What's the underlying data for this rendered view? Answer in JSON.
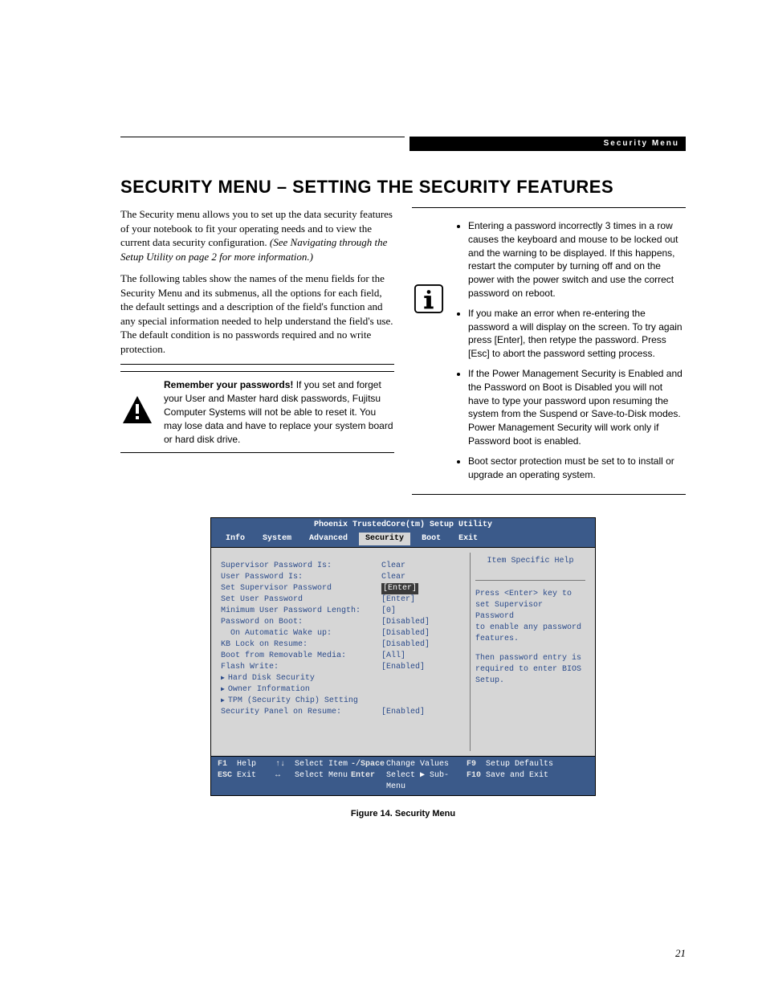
{
  "header": {
    "band": "Security Menu"
  },
  "title": "SECURITY MENU – SETTING THE SECURITY FEATURES",
  "left": {
    "p1a": "The Security menu allows you to set up the data security features of your notebook to fit your operating needs and to view the current data security configuration. ",
    "p1b": "(See Navigating through the Setup Utility on page 2 for more information.)",
    "p2": "The following tables show the names of the menu fields for the Security Menu and its submenus, all the options for each field, the default settings and a description of the field's function and any special information needed to help understand the field's use. The default condition is no passwords required and no write protection.",
    "warn_strong": "Remember your passwords!",
    "warn_text": " If you set and forget your User and Master hard disk passwords, Fujitsu Computer Systems will not be able to reset it. You may lose data and have to replace your system board or hard disk drive."
  },
  "right": {
    "b1": "Entering a password incorrectly 3 times in a row causes the keyboard and mouse to be locked out and the warning to be displayed. If this happens, restart the computer by turning off and on the power with the power switch and use the correct password on reboot.",
    "b2": "If you make an error when re-entering the password a will display on the screen. To try again press [Enter], then retype the password. Press [Esc] to abort the password setting process.",
    "b3": "If the Power Management Security is Enabled and the Password on Boot is Disabled you will not have to type your password upon resuming the system from the Suspend or Save-to-Disk modes. Power Management Security will work only if Password boot is enabled.",
    "b4": "Boot sector protection must be set to to install or upgrade an operating system."
  },
  "bios": {
    "utility_title": "Phoenix TrustedCore(tm) Setup Utility",
    "tabs": [
      "Info",
      "System",
      "Advanced",
      "Security",
      "Boot",
      "Exit"
    ],
    "active_tab": "Security",
    "fields": [
      {
        "label": "Supervisor Password Is:",
        "value": "Clear"
      },
      {
        "label": "User Password Is:",
        "value": "Clear"
      },
      {
        "label": "",
        "value": ""
      },
      {
        "label": "Set Supervisor Password",
        "value": "[Enter]",
        "selected": true
      },
      {
        "label": "Set User Password",
        "value": "[Enter]"
      },
      {
        "label": "Minimum User Password Length:",
        "value": "[0]"
      },
      {
        "label": "Password on Boot:",
        "value": "[Disabled]"
      },
      {
        "label": "  On Automatic Wake up:",
        "value": "[Disabled]"
      },
      {
        "label": "KB Lock on Resume:",
        "value": "[Disabled]"
      },
      {
        "label": "Boot from Removable Media:",
        "value": "[All]"
      },
      {
        "label": "Flash Write:",
        "value": "[Enabled]"
      },
      {
        "label": "Hard Disk Security",
        "value": "",
        "submenu": true
      },
      {
        "label": "Owner Information",
        "value": "",
        "submenu": true
      },
      {
        "label": "TPM (Security Chip) Setting",
        "value": "",
        "submenu": true
      },
      {
        "label": "Security Panel on Resume:",
        "value": "[Enabled]"
      }
    ],
    "help": {
      "title": "Item Specific Help",
      "l1": "Press <Enter> key to",
      "l2": "set Supervisor Password",
      "l3": "to enable any password",
      "l4": "features.",
      "l5": "Then password entry is",
      "l6": "required to enter BIOS",
      "l7": "Setup."
    },
    "footer": {
      "k1": "F1",
      "d1": "Help",
      "k2": "↑↓",
      "d2": "Select Item",
      "k3": "-/Space",
      "d3": "Change Values",
      "k4": "F9",
      "d4": "Setup Defaults",
      "k5": "ESC",
      "d5": "Exit",
      "k6": "↔",
      "d6": "Select Menu",
      "k7": "Enter",
      "d7": "Select ▶ Sub-Menu",
      "k8": "F10",
      "d8": "Save and Exit"
    }
  },
  "caption": "Figure 14.  Security Menu",
  "page_number": "21"
}
